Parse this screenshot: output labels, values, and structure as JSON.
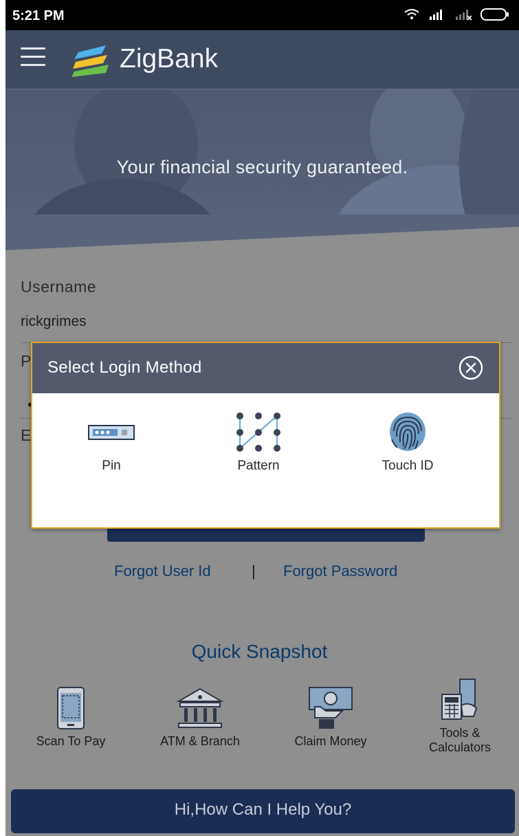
{
  "status_bar": {
    "time": "5:21 PM"
  },
  "header": {
    "brand": "ZigBank"
  },
  "hero": {
    "tagline": "Your financial security guaranteed."
  },
  "login_form": {
    "username_label": "Username",
    "username_value": "rickgrimes",
    "password_label_partial": "P",
    "password_mask": "•",
    "third_label_partial": "E"
  },
  "links": {
    "forgot_user": "Forgot User Id",
    "separator": "|",
    "forgot_password": "Forgot Password"
  },
  "quick_snapshot": {
    "title": "Quick Snapshot",
    "items": [
      {
        "label": "Scan To Pay",
        "icon": "qr-phone-icon"
      },
      {
        "label": "ATM & Branch",
        "icon": "bank-building-icon"
      },
      {
        "label": "Claim Money",
        "icon": "money-hand-icon"
      },
      {
        "label": "Tools & Calculators",
        "icon": "calculator-icon"
      }
    ]
  },
  "help_button": {
    "label": "Hi,How Can I Help You?"
  },
  "modal": {
    "title": "Select Login Method",
    "methods": [
      {
        "label": "Pin",
        "icon": "pin-icon"
      },
      {
        "label": "Pattern",
        "icon": "pattern-icon"
      },
      {
        "label": "Touch ID",
        "icon": "fingerprint-icon"
      }
    ]
  },
  "colors": {
    "header_bg": "#3e4a60",
    "modal_border": "#e0a826",
    "link_blue": "#0a3a6a",
    "button_navy": "#1a2d54"
  }
}
